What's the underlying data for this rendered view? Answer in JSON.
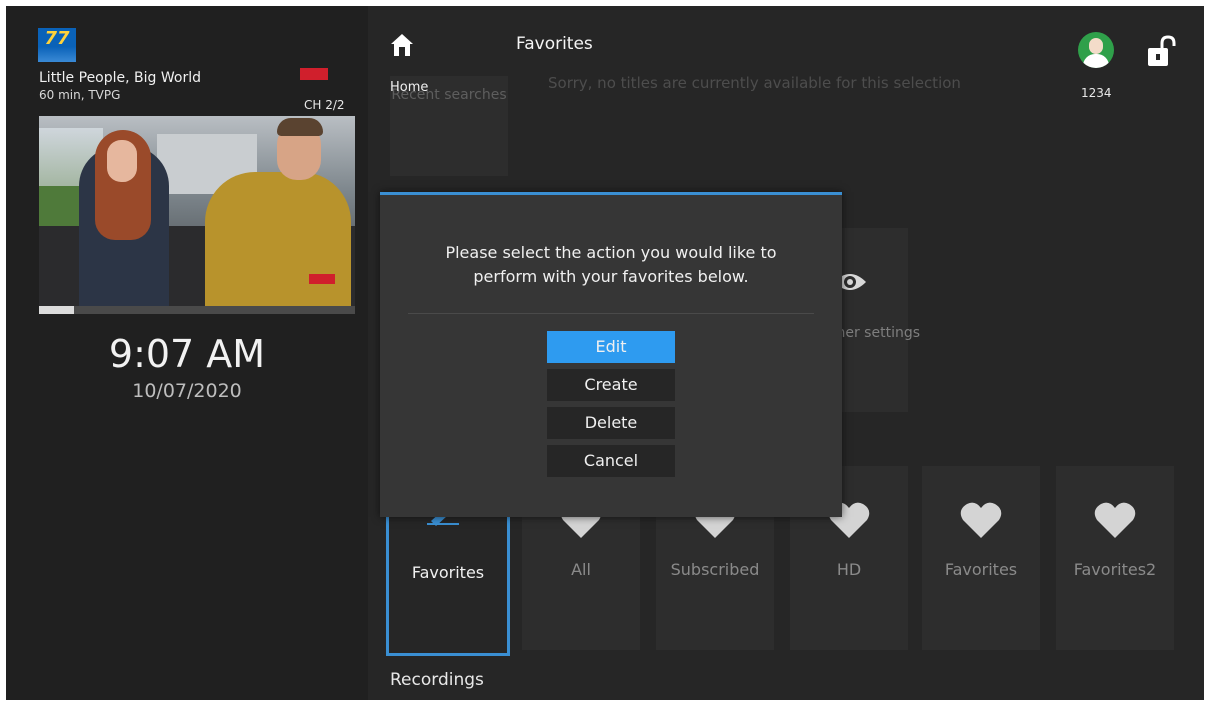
{
  "left_panel": {
    "channel_logo_text": "77",
    "program_title": "Little People, Big World",
    "program_meta": "60 min, TVPG",
    "channel_number": "CH 2/2",
    "playback_progress_fraction": 0.11,
    "clock_time": "9:07 AM",
    "clock_date": "10/07/2020"
  },
  "header": {
    "home_label": "Home",
    "title": "Favorites",
    "profile_id": "1234",
    "icons": [
      "home-icon",
      "profile-avatar",
      "unlock-icon"
    ]
  },
  "background": {
    "recent_searches": "Recent searches",
    "no_titles_message": "Sorry, no titles are currently available for this selection",
    "other_settings": "Other settings"
  },
  "favorites_row": {
    "tiles": [
      {
        "label": "Favorites",
        "icon": "pencil-icon",
        "selected": true
      },
      {
        "label": "All",
        "icon": "heart-icon"
      },
      {
        "label": "Subscribed",
        "icon": "heart-icon"
      },
      {
        "label": "HD",
        "icon": "heart-icon"
      },
      {
        "label": "Favorites",
        "icon": "heart-icon"
      },
      {
        "label": "Favorites2",
        "icon": "heart-icon"
      }
    ]
  },
  "recordings_label": "Recordings",
  "dialog": {
    "message_line1": "Please select the action you would like to",
    "message_line2": "perform with your favorites below.",
    "buttons": [
      {
        "label": "Edit",
        "active": true
      },
      {
        "label": "Create"
      },
      {
        "label": "Delete"
      },
      {
        "label": "Cancel"
      }
    ]
  },
  "colors": {
    "accent": "#2e9bf0",
    "selection_border": "#3a8fd3",
    "background": "#262626"
  }
}
